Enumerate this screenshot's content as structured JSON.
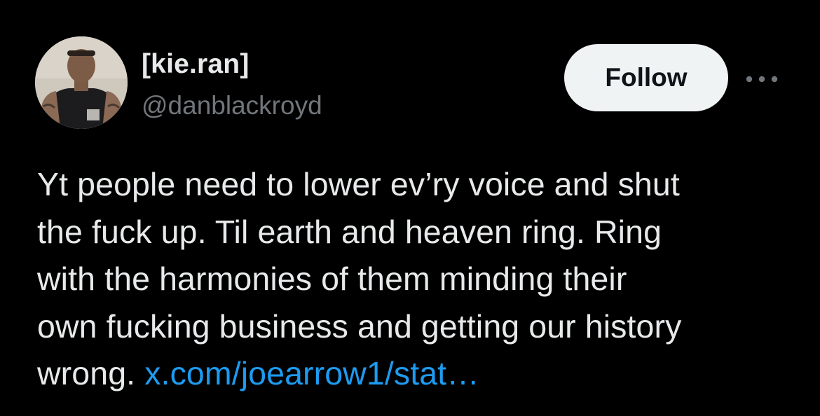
{
  "author": {
    "display_name": "[kie.ran]",
    "handle": "@danblackroyd"
  },
  "actions": {
    "follow_label": "Follow",
    "more_icon": "more-horizontal-icon"
  },
  "tweet": {
    "line1": "Yt people need to lower ev’ry voice and shut",
    "line2": "the fuck up. Til earth and heaven ring. Ring",
    "line3": "with the harmonies of them minding their",
    "line4": "own fucking business and getting our history",
    "line5_text": "wrong.",
    "link": "x.com/joearrow1/stat…"
  },
  "colors": {
    "background": "#000000",
    "text": "#e7e9ea",
    "secondary_text": "#71767b",
    "link": "#1d9bf0",
    "follow_bg": "#eff3f4"
  }
}
